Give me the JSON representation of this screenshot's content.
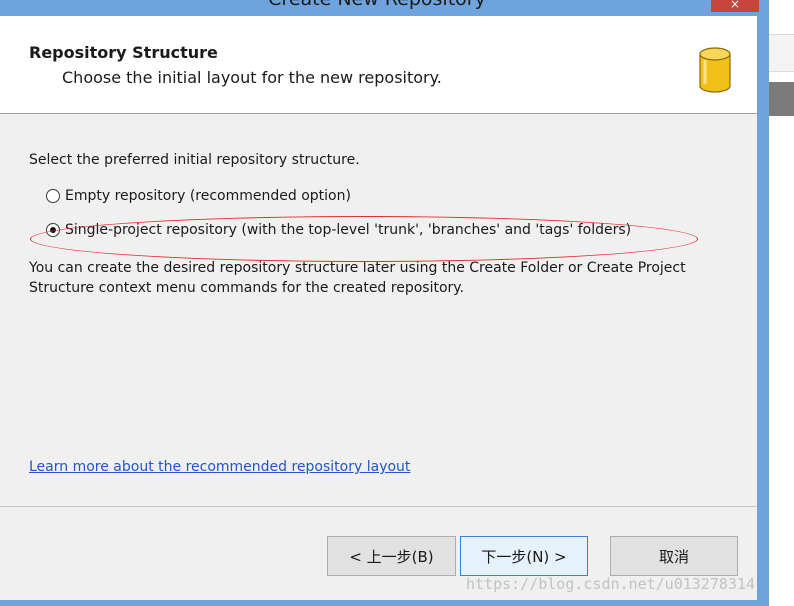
{
  "window": {
    "title": "Create New Repository",
    "close_glyph": "×"
  },
  "header": {
    "title": "Repository Structure",
    "subtitle": "Choose the initial layout for the new repository.",
    "icon": "database-icon"
  },
  "content": {
    "prompt": "Select the preferred initial repository structure.",
    "options": [
      {
        "label": "Empty repository (recommended option)",
        "checked": false
      },
      {
        "label": "Single-project repository (with the top-level 'trunk', 'branches' and 'tags' folders)",
        "checked": true
      }
    ],
    "note_line1": "You can create the desired repository structure later using the Create Folder or Create Project",
    "note_line2": "Structure context menu commands for the created repository.",
    "learn_more_link": "Learn more about the recommended repository layout"
  },
  "buttons": {
    "back": "< 上一步(B)",
    "next": "下一步(N) >",
    "cancel": "取消"
  },
  "watermark": "https://blog.csdn.net/u013278314",
  "colors": {
    "frame": "#6fa3dc",
    "close_button": "#c7453a",
    "annotation": "#e03030",
    "link": "#2255cc",
    "icon_gold": "#f2c01a"
  }
}
